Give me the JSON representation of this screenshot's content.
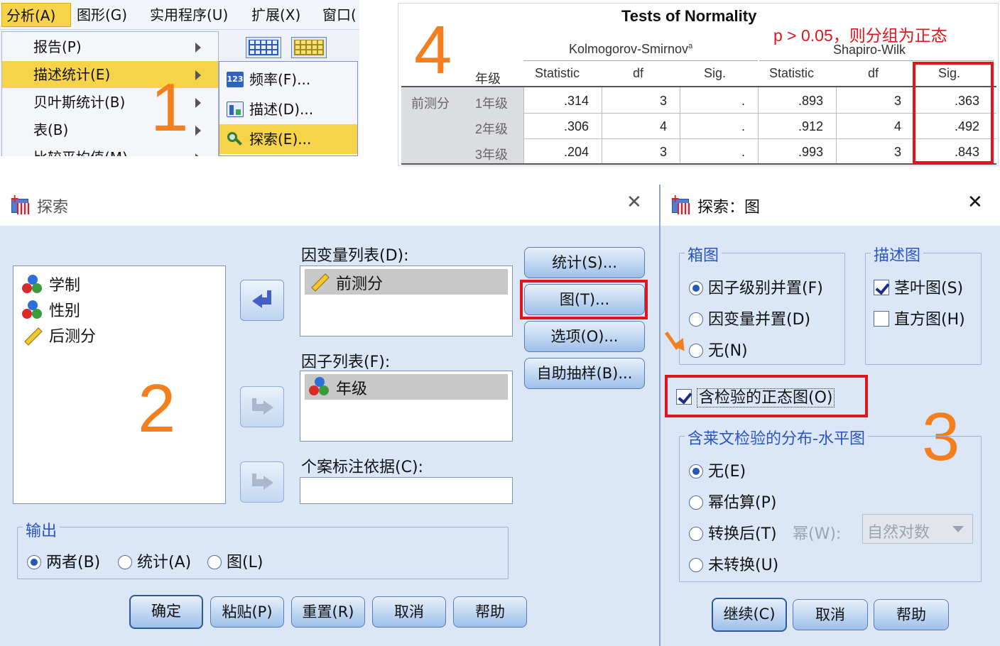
{
  "menu": {
    "bar": [
      "分析(A)",
      "图形(G)",
      "实用程序(U)",
      "扩展(X)",
      "窗口("
    ],
    "items": [
      "报告(P)",
      "描述统计(E)",
      "贝叶斯统计(B)",
      "表(B)",
      "比较平均值(M)"
    ],
    "submenu": [
      {
        "label": "频率(F)...",
        "icon": "frequency-icon"
      },
      {
        "label": "描述(D)...",
        "icon": "descriptives-icon"
      },
      {
        "label": "探索(E)...",
        "icon": "explore-icon"
      }
    ],
    "step": "1"
  },
  "normality": {
    "step": "4",
    "title": "Tests of Normality",
    "note": "p > 0.05，则分组为正态",
    "group_ks": "Kolmogorov-Smirnov",
    "group_ks_sup": "a",
    "group_sw": "Shapiro-Wilk",
    "factor_col": "年级",
    "var_label": "前测分",
    "headers": [
      "Statistic",
      "df",
      "Sig.",
      "Statistic",
      "df",
      "Sig."
    ],
    "rows": [
      {
        "level": "1年级",
        "ks_stat": ".314",
        "ks_df": "3",
        "ks_sig": ".",
        "sw_stat": ".893",
        "sw_df": "3",
        "sw_sig": ".363"
      },
      {
        "level": "2年级",
        "ks_stat": ".306",
        "ks_df": "4",
        "ks_sig": ".",
        "sw_stat": ".912",
        "sw_df": "4",
        "sw_sig": ".492"
      },
      {
        "level": "3年级",
        "ks_stat": ".204",
        "ks_df": "3",
        "ks_sig": ".",
        "sw_stat": ".993",
        "sw_df": "3",
        "sw_sig": ".843"
      }
    ]
  },
  "explore": {
    "title": "探索",
    "close": "✕",
    "step": "2",
    "variables": [
      "学制",
      "性别",
      "后测分"
    ],
    "dependent_label": "因变量列表(D):",
    "dependent_items": [
      "前测分"
    ],
    "factor_label": "因子列表(F):",
    "factor_items": [
      "年级"
    ],
    "case_label": "个案标注依据(C):",
    "side_buttons": [
      "统计(S)...",
      "图(T)...",
      "选项(O)...",
      "自助抽样(B)..."
    ],
    "output_label": "输出",
    "output_options": [
      "两者(B)",
      "统计(A)",
      "图(L)"
    ],
    "output_selected": 0,
    "bottom_buttons": [
      "确定",
      "粘贴(P)",
      "重置(R)",
      "取消",
      "帮助"
    ]
  },
  "plots": {
    "title": "探索：图",
    "close": "✕",
    "step": "3",
    "boxplot_label": "箱图",
    "boxplot_options": [
      "因子级别并置(F)",
      "因变量并置(D)",
      "无(N)"
    ],
    "boxplot_selected": 0,
    "desc_label": "描述图",
    "desc_options": [
      {
        "label": "茎叶图(S)",
        "checked": true
      },
      {
        "label": "直方图(H)",
        "checked": false
      }
    ],
    "normality_plot": {
      "label": "含检验的正态图(O)",
      "checked": true
    },
    "spread_label": "含莱文检验的分布-水平图",
    "spread_options": [
      "无(E)",
      "幂估算(P)",
      "转换后(T)",
      "未转换(U)"
    ],
    "spread_selected": 0,
    "power_label": "幂(W):",
    "power_value": "自然对数",
    "buttons": [
      "继续(C)",
      "取消",
      "帮助"
    ]
  },
  "colors": {
    "highlight": "#e0151d",
    "step": "#f47f1e",
    "menu_select": "#f7d34a"
  }
}
